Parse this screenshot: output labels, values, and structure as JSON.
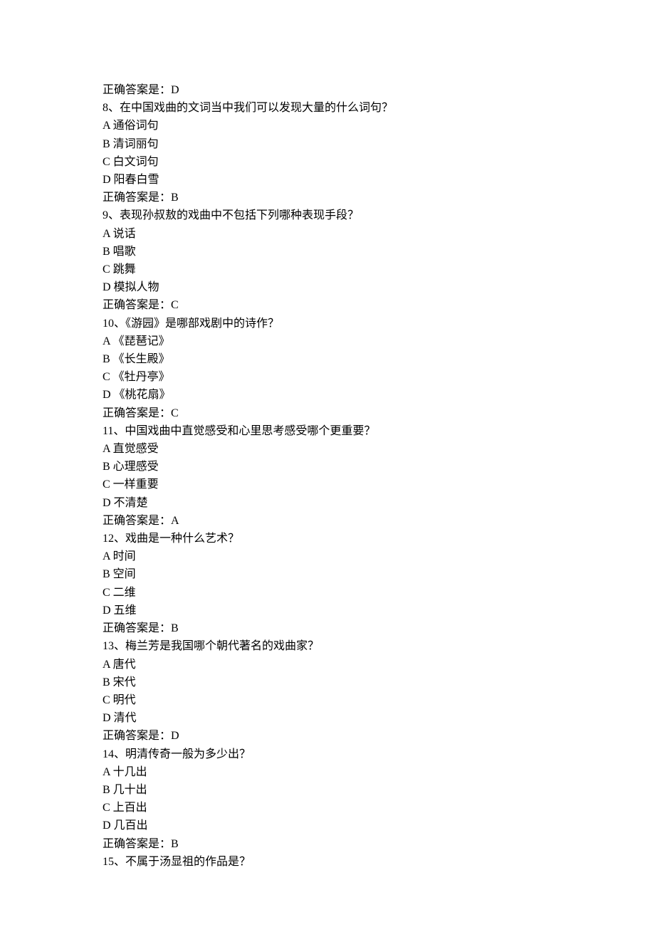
{
  "answer_prefix": "正确答案是：",
  "questions": [
    {
      "number": "8",
      "correct_preceding": "D",
      "text": "在中国戏曲的文词当中我们可以发现大量的什么词句？",
      "options": [
        {
          "letter": "A",
          "label": "通俗词句"
        },
        {
          "letter": "B",
          "label": "清词丽句"
        },
        {
          "letter": "C",
          "label": "白文词句"
        },
        {
          "letter": "D",
          "label": "阳春白雪"
        }
      ],
      "correct": "B"
    },
    {
      "number": "9",
      "text": "表现孙叔敖的戏曲中不包括下列哪种表现手段？",
      "options": [
        {
          "letter": "A",
          "label": "说话"
        },
        {
          "letter": "B",
          "label": "唱歌"
        },
        {
          "letter": "C",
          "label": "跳舞"
        },
        {
          "letter": "D",
          "label": "模拟人物"
        }
      ],
      "correct": "C"
    },
    {
      "number": "10",
      "text": "《游园》是哪部戏剧中的诗作？",
      "options": [
        {
          "letter": "A",
          "label": "《琵琶记》"
        },
        {
          "letter": "B",
          "label": "《长生殿》"
        },
        {
          "letter": "C",
          "label": "《牡丹亭》"
        },
        {
          "letter": "D",
          "label": "《桃花扇》"
        }
      ],
      "correct": "C"
    },
    {
      "number": "11",
      "text": "中国戏曲中直觉感受和心里思考感受哪个更重要？",
      "options": [
        {
          "letter": "A",
          "label": "直觉感受"
        },
        {
          "letter": "B",
          "label": "心理感受"
        },
        {
          "letter": "C",
          "label": "一样重要"
        },
        {
          "letter": "D",
          "label": "不清楚"
        }
      ],
      "correct": "A"
    },
    {
      "number": "12",
      "text": "戏曲是一种什么艺术？",
      "options": [
        {
          "letter": "A",
          "label": "时间"
        },
        {
          "letter": "B",
          "label": "空间"
        },
        {
          "letter": "C",
          "label": "二维"
        },
        {
          "letter": "D",
          "label": "五维"
        }
      ],
      "correct": "B"
    },
    {
      "number": "13",
      "text": "梅兰芳是我国哪个朝代著名的戏曲家？",
      "options": [
        {
          "letter": "A",
          "label": "唐代"
        },
        {
          "letter": "B",
          "label": "宋代"
        },
        {
          "letter": "C",
          "label": "明代"
        },
        {
          "letter": "D",
          "label": "清代"
        }
      ],
      "correct": "D"
    },
    {
      "number": "14",
      "text": "明清传奇一般为多少出？",
      "options": [
        {
          "letter": "A",
          "label": "十几出"
        },
        {
          "letter": "B",
          "label": "几十出"
        },
        {
          "letter": "C",
          "label": "上百出"
        },
        {
          "letter": "D",
          "label": "几百出"
        }
      ],
      "correct": "B"
    },
    {
      "number": "15",
      "text": "不属于汤显祖的作品是？",
      "options": [],
      "correct": null
    }
  ]
}
